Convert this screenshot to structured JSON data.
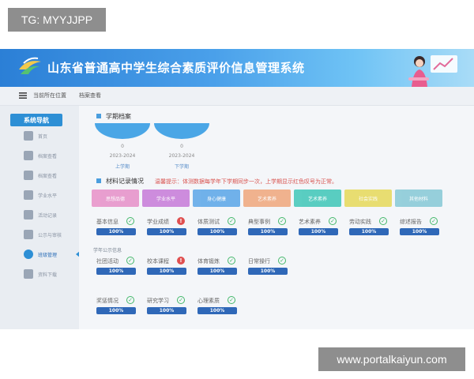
{
  "watermark_tl": "TG: MYYJJPP",
  "watermark_br": "www.portalkaiyun.com",
  "header": {
    "title": "山东省普通高中学生综合素质评价信息管理系统"
  },
  "breadcrumb": {
    "current_label": "当前所在位置",
    "page": "档案查看"
  },
  "sidebar": {
    "heading": "系统导航",
    "items": [
      {
        "label": "首页"
      },
      {
        "label": "档案查看"
      },
      {
        "label": "档案查看"
      },
      {
        "label": "学业水平"
      },
      {
        "label": "活动记录"
      },
      {
        "label": "公示与审核"
      },
      {
        "label": "班级管理"
      },
      {
        "label": "资料下载"
      }
    ]
  },
  "terms_section": {
    "title": "学期档案",
    "terms": [
      {
        "count": "0",
        "year": "2023-2024",
        "name": "上学期"
      },
      {
        "count": "0",
        "year": "2023-2024",
        "name": "下学期"
      }
    ]
  },
  "materials_section": {
    "title": "材料记录情况",
    "hint": "温馨提示：体测数据每学年下学期同步一次，上学期显示红色叹号为正常。",
    "categories": [
      {
        "label": "思想品德",
        "color": "#e78fc8"
      },
      {
        "label": "学业水平",
        "color": "#c77ad9"
      },
      {
        "label": "身心健康",
        "color": "#5aa6e8"
      },
      {
        "label": "艺术素养",
        "color": "#f0a77c"
      },
      {
        "label": "艺术素养",
        "color": "#3fc7b8"
      },
      {
        "label": "社会实践",
        "color": "#e6d95a"
      },
      {
        "label": "其他材料",
        "color": "#86c9d6"
      }
    ],
    "items_row1": [
      {
        "label": "基本信息",
        "status": "ok",
        "progress": "100%"
      },
      {
        "label": "学业成绩",
        "status": "warn",
        "progress": "100%"
      },
      {
        "label": "体质测试",
        "status": "ok",
        "progress": "100%"
      },
      {
        "label": "典型事例",
        "status": "ok",
        "progress": "100%"
      },
      {
        "label": "艺术素养",
        "status": "ok",
        "progress": "100%"
      },
      {
        "label": "劳动实践",
        "status": "ok",
        "progress": "100%"
      },
      {
        "label": "综述报告",
        "status": "ok",
        "progress": "100%"
      }
    ],
    "sub_heading": "学年公示信息",
    "items_row2": [
      {
        "label": "社团活动",
        "status": "ok",
        "progress": "100%"
      },
      {
        "label": "校本课程",
        "status": "warn",
        "progress": "100%"
      },
      {
        "label": "体育锻炼",
        "status": "ok",
        "progress": "100%"
      },
      {
        "label": "日常操行",
        "status": "ok",
        "progress": "100%"
      }
    ],
    "items_row3": [
      {
        "label": "奖惩情况",
        "status": "ok",
        "progress": "100%"
      },
      {
        "label": "研究学习",
        "status": "ok",
        "progress": "100%"
      },
      {
        "label": "心理素质",
        "status": "ok",
        "progress": "100%"
      }
    ]
  },
  "colors": {
    "brand": "#2d8fd5",
    "bar": "#2f68b8",
    "ok": "#44b86a",
    "warn": "#e05050"
  }
}
